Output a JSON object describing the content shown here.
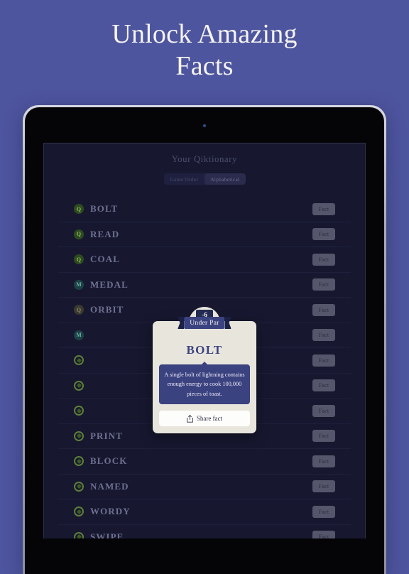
{
  "promo": {
    "headline_line1": "Unlock Amazing",
    "headline_line2": "Facts",
    "background_color": "#4e559f",
    "text_color": "#f4f3ef"
  },
  "device": {
    "type": "tablet",
    "bezel_color": "#050508",
    "frame_color": "#a9abb8",
    "camera": "camera-dot"
  },
  "app": {
    "title": "Your Qiktionary",
    "background_color": "#171830",
    "sort_control": {
      "options": [
        {
          "label": "Game Order",
          "active": false
        },
        {
          "label": "Alphabetical",
          "active": true
        }
      ]
    },
    "fact_button_label": "Fact",
    "words": [
      {
        "label": "BOLT",
        "badge": "Q",
        "badge_type": "q"
      },
      {
        "label": "READ",
        "badge": "Q",
        "badge_type": "q"
      },
      {
        "label": "COAL",
        "badge": "Q",
        "badge_type": "q"
      },
      {
        "label": "MEDAL",
        "badge": "M",
        "badge_type": "m"
      },
      {
        "label": "ORBIT",
        "badge": "Q",
        "badge_type": "gray"
      },
      {
        "label": "",
        "badge": "M",
        "badge_type": "m"
      },
      {
        "label": "",
        "badge": "",
        "badge_type": "ring"
      },
      {
        "label": "",
        "badge": "",
        "badge_type": "ring"
      },
      {
        "label": "",
        "badge": "",
        "badge_type": "ring"
      },
      {
        "label": "PRINT",
        "badge": "",
        "badge_type": "ring"
      },
      {
        "label": "BLOCK",
        "badge": "",
        "badge_type": "ring"
      },
      {
        "label": "NAMED",
        "badge": "",
        "badge_type": "ring"
      },
      {
        "label": "WORDY",
        "badge": "",
        "badge_type": "ring"
      },
      {
        "label": "SWIPE",
        "badge": "",
        "badge_type": "ring"
      }
    ]
  },
  "modal": {
    "score": "-6",
    "ribbon_label": "Under Par",
    "word": "BOLT",
    "fact_text": "A single bolt of lightning contains enough energy to cook 100,000 pieces of toast.",
    "share_label": "Share fact",
    "accent_color": "#3b4280",
    "card_color": "#e8e6dc"
  }
}
